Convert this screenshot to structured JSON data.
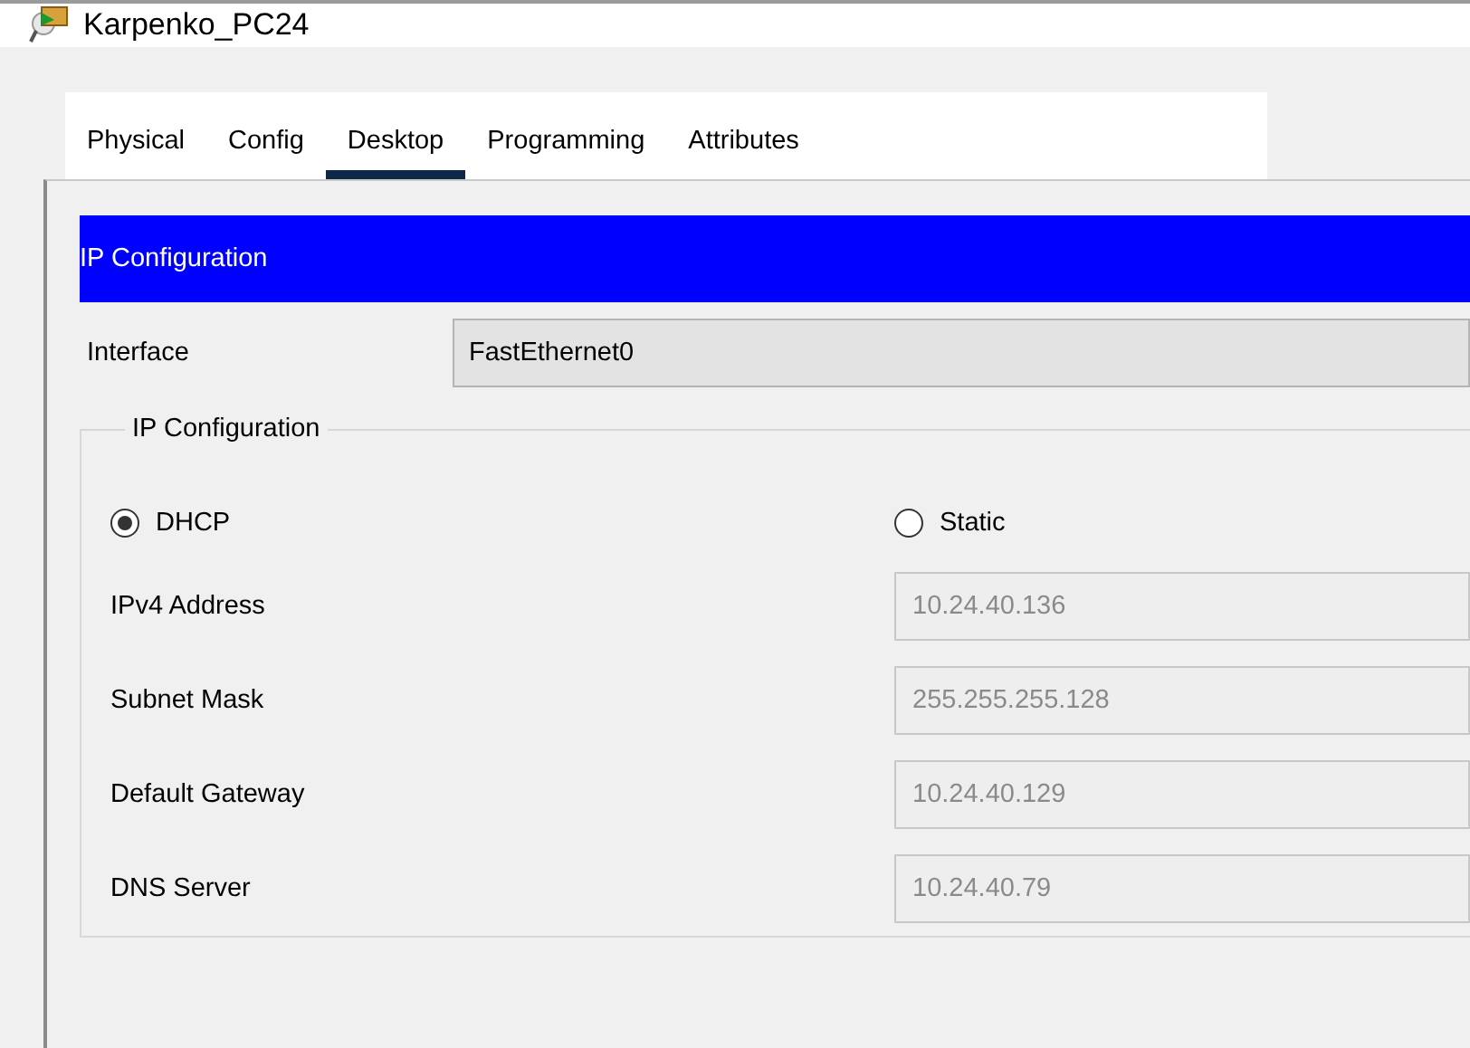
{
  "window": {
    "title": "Karpenko_PC24"
  },
  "tabs": [
    {
      "label": "Physical",
      "selected": false
    },
    {
      "label": "Config",
      "selected": false
    },
    {
      "label": "Desktop",
      "selected": true
    },
    {
      "label": "Programming",
      "selected": false
    },
    {
      "label": "Attributes",
      "selected": false
    }
  ],
  "header": {
    "title": "IP Configuration"
  },
  "interface": {
    "label": "Interface",
    "value": "FastEthernet0"
  },
  "group": {
    "title": "IP Configuration",
    "modes": [
      {
        "label": "DHCP",
        "selected": true
      },
      {
        "label": "Static",
        "selected": false
      }
    ],
    "fields": [
      {
        "label": "IPv4 Address",
        "value": "10.24.40.136",
        "disabled": true
      },
      {
        "label": "Subnet Mask",
        "value": "255.255.255.128",
        "disabled": true
      },
      {
        "label": "Default Gateway",
        "value": "10.24.40.129",
        "disabled": true
      },
      {
        "label": "DNS Server",
        "value": "10.24.40.79",
        "disabled": true
      }
    ]
  }
}
